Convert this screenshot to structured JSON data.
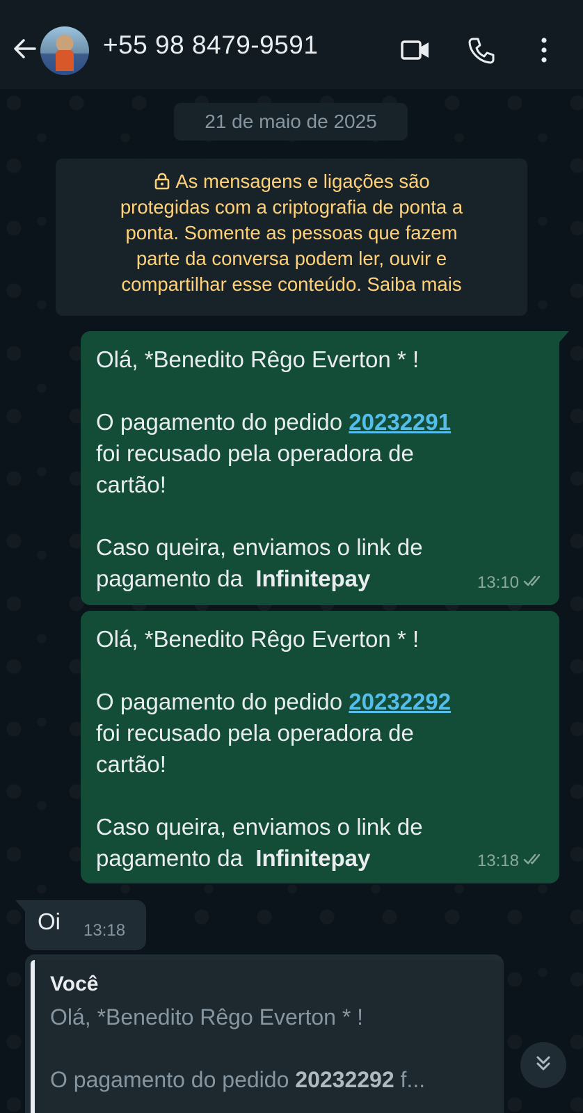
{
  "header": {
    "contact": "+55 98 8479-9591",
    "icons": [
      "back-arrow-icon",
      "video-call-icon",
      "voice-call-icon",
      "more-options-icon"
    ]
  },
  "chat": {
    "date_chip": "21 de maio de 2025",
    "encryption_notice": {
      "line1": "As mensagens e ligações são",
      "line2": "protegidas com a criptografia de ponta a",
      "line3": "ponta. Somente as pessoas que fazem",
      "line4": "parte da conversa podem ler, ouvir e",
      "line5": "compartilhar esse conteúdo. Saiba mais"
    },
    "messages": [
      {
        "greeting": "Olá, *Benedito Rêgo Everton * !",
        "order_prefix": "O pagamento do pedido ",
        "order_number": "20232291",
        "refused_line": "foi recusado pela operadora de",
        "refused_line2": "cartão!",
        "link_line": "Caso queira, enviamos o link de",
        "pay_prefix": "pagamento da  ",
        "pay_brand": "Infinitepay",
        "time": "13:10"
      },
      {
        "greeting": "Olá, *Benedito Rêgo Everton * !",
        "order_prefix": "O pagamento do pedido ",
        "order_number": "20232292",
        "refused_line": "foi recusado pela operadora de",
        "refused_line2": "cartão!",
        "link_line": "Caso queira, enviamos o link de",
        "pay_prefix": "pagamento da  ",
        "pay_brand": "Infinitepay",
        "time": "13:18"
      }
    ],
    "incoming": {
      "text": "Oi",
      "time": "13:18"
    },
    "reply_preview": {
      "author": "Você",
      "line1": "Olá, *Benedito Rêgo Everton * !",
      "line2_prefix": "O pagamento do pedido ",
      "line2_bold": "20232292",
      "line2_suffix": " f..."
    }
  },
  "colors": {
    "background": "#0b141a",
    "header": "#111b21",
    "outgoing_bubble": "#144d37",
    "incoming_bubble": "#202c33",
    "notice_text": "#ffd279",
    "link": "#53bdeb"
  }
}
